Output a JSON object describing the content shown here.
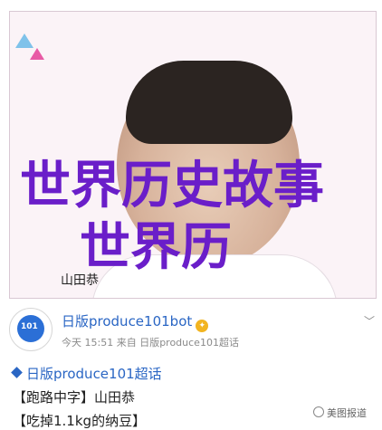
{
  "overlay": {
    "line1": "世界历史故事",
    "line2": "世界历"
  },
  "photo": {
    "caption_name": "山田恭"
  },
  "post": {
    "avatar_text": "101",
    "author": "日版produce101bot",
    "meta": "今天 15:51 来自 日版produce101超话",
    "tag": "日版produce101超话",
    "line1": "【跑路中字】山田恭",
    "line2": "【吃掉1.1kg的纳豆】"
  },
  "watermark": {
    "text": "美图报道"
  },
  "icons": [
    "verified-badge-icon",
    "chevron-down-icon",
    "diamond-icon",
    "watermark-logo-icon"
  ],
  "colors": {
    "overlay_text": "#6a1ec9",
    "link_blue": "#2a66c4",
    "meta_gray": "#8a8a8a"
  }
}
